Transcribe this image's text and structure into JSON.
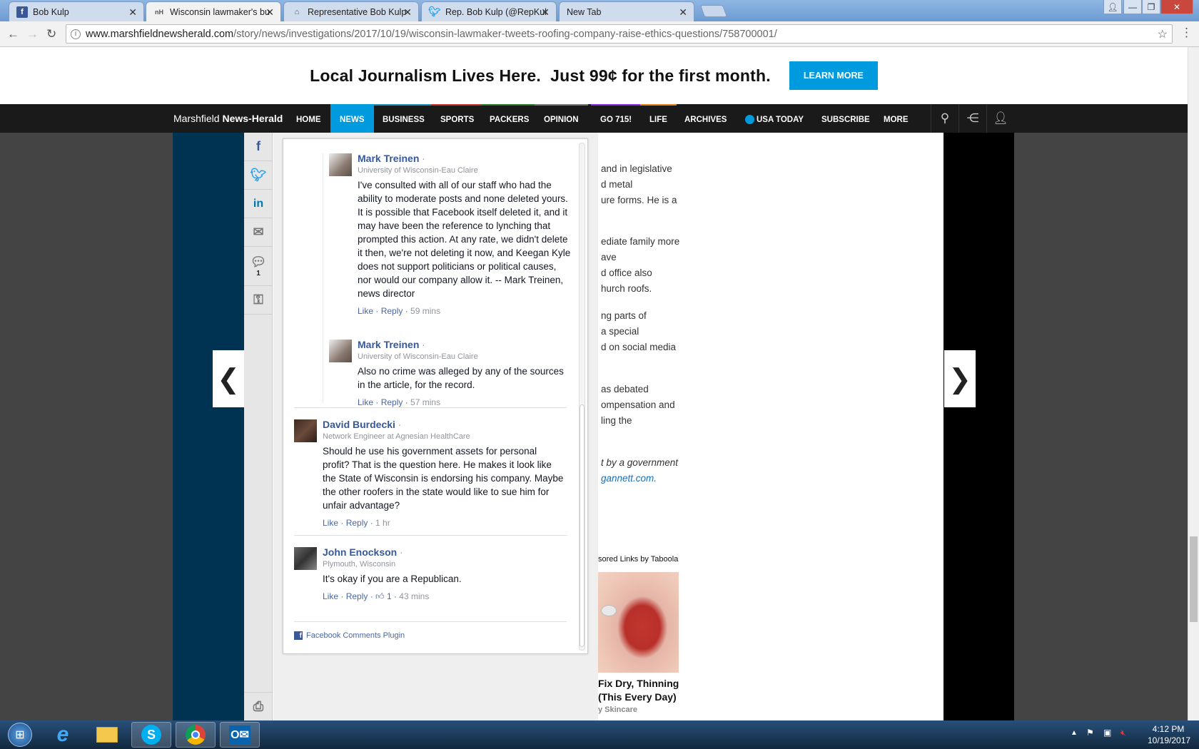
{
  "browser": {
    "tabs": [
      {
        "label": "Bob Kulp",
        "icon": "facebook-icon",
        "active": false
      },
      {
        "label": "Wisconsin lawmaker's bu",
        "icon": "newspaper-icon",
        "active": true
      },
      {
        "label": "Representative Bob Kulp",
        "icon": "capitol-icon",
        "active": false
      },
      {
        "label": "Rep. Bob Kulp (@RepKul",
        "icon": "twitter-icon",
        "active": false
      },
      {
        "label": "New Tab",
        "icon": "",
        "active": false
      }
    ],
    "url_host": "www.marshfieldnewsherald.com",
    "url_path": "/story/news/investigations/2017/10/19/wisconsin-lawmaker-tweets-roofing-company-raise-ethics-questions/758700001/"
  },
  "promo": {
    "text": "Local Journalism Lives Here.  Just 99¢ for the first month.",
    "button": "LEARN MORE"
  },
  "nav": {
    "brand_light": "Marshfield",
    "brand_bold": "News-Herald",
    "items": [
      "HOME",
      "NEWS",
      "BUSINESS",
      "SPORTS",
      "PACKERS",
      "OPINION",
      "GO 715!",
      "LIFE",
      "ARCHIVES",
      "USA TODAY",
      "SUBSCRIBE",
      "MORE"
    ],
    "active": "NEWS"
  },
  "share": {
    "comment_count": "1"
  },
  "comments": [
    {
      "name": "Mark Treinen",
      "sub": "University of Wisconsin-Eau Claire",
      "body": "I've consulted with all of our staff who had the ability to moderate posts and none deleted yours. It is possible that Facebook itself deleted it, and it may have been the reference to lynching that prompted this action. At any rate, we didn't delete it then, we're not deleting it now, and Keegan Kyle does not support politicians or political causes, nor would our company allow it. -- Mark Treinen, news director",
      "like": "Like",
      "reply": "Reply",
      "time": "59 mins"
    },
    {
      "name": "Mark Treinen",
      "sub": "University of Wisconsin-Eau Claire",
      "body": "Also no crime was alleged by any of the sources in the article, for the record.",
      "like": "Like",
      "reply": "Reply",
      "time": "57 mins"
    },
    {
      "name": "David Burdecki",
      "sub": "Network Engineer at Agnesian HealthCare",
      "body": "Should he use his government assets for personal profit? That is the question here. He makes it look like the State of Wisconsin is endorsing his company. Maybe the other roofers in the state would like to sue him for unfair advantage?",
      "like": "Like",
      "reply": "Reply",
      "time": "1 hr"
    },
    {
      "name": "John Enockson",
      "sub": "Plymouth, Wisconsin",
      "body": "It's okay if you are a Republican.",
      "like": "Like",
      "reply": "Reply",
      "likes": "1",
      "time": "43 mins"
    }
  ],
  "plugin_label": "Facebook Comments Plugin",
  "article_fragments": [
    "and in legislative",
    "d metal",
    "ure forms. He is a",
    "ediate family more",
    "ave",
    "d office also",
    "hurch roofs.",
    "ng parts of",
    "a special",
    "d on social media",
    "as debated",
    "ompensation and",
    "ling the",
    "t by a government",
    "gannett.com."
  ],
  "taboola": {
    "header": "sored Links by Taboola",
    "headline_1": "Fix Dry, Thinning",
    "headline_2": "(This Every Day)",
    "source": "y Skincare"
  },
  "taskbar": {
    "time": "4:12 PM",
    "date": "10/19/2017"
  }
}
